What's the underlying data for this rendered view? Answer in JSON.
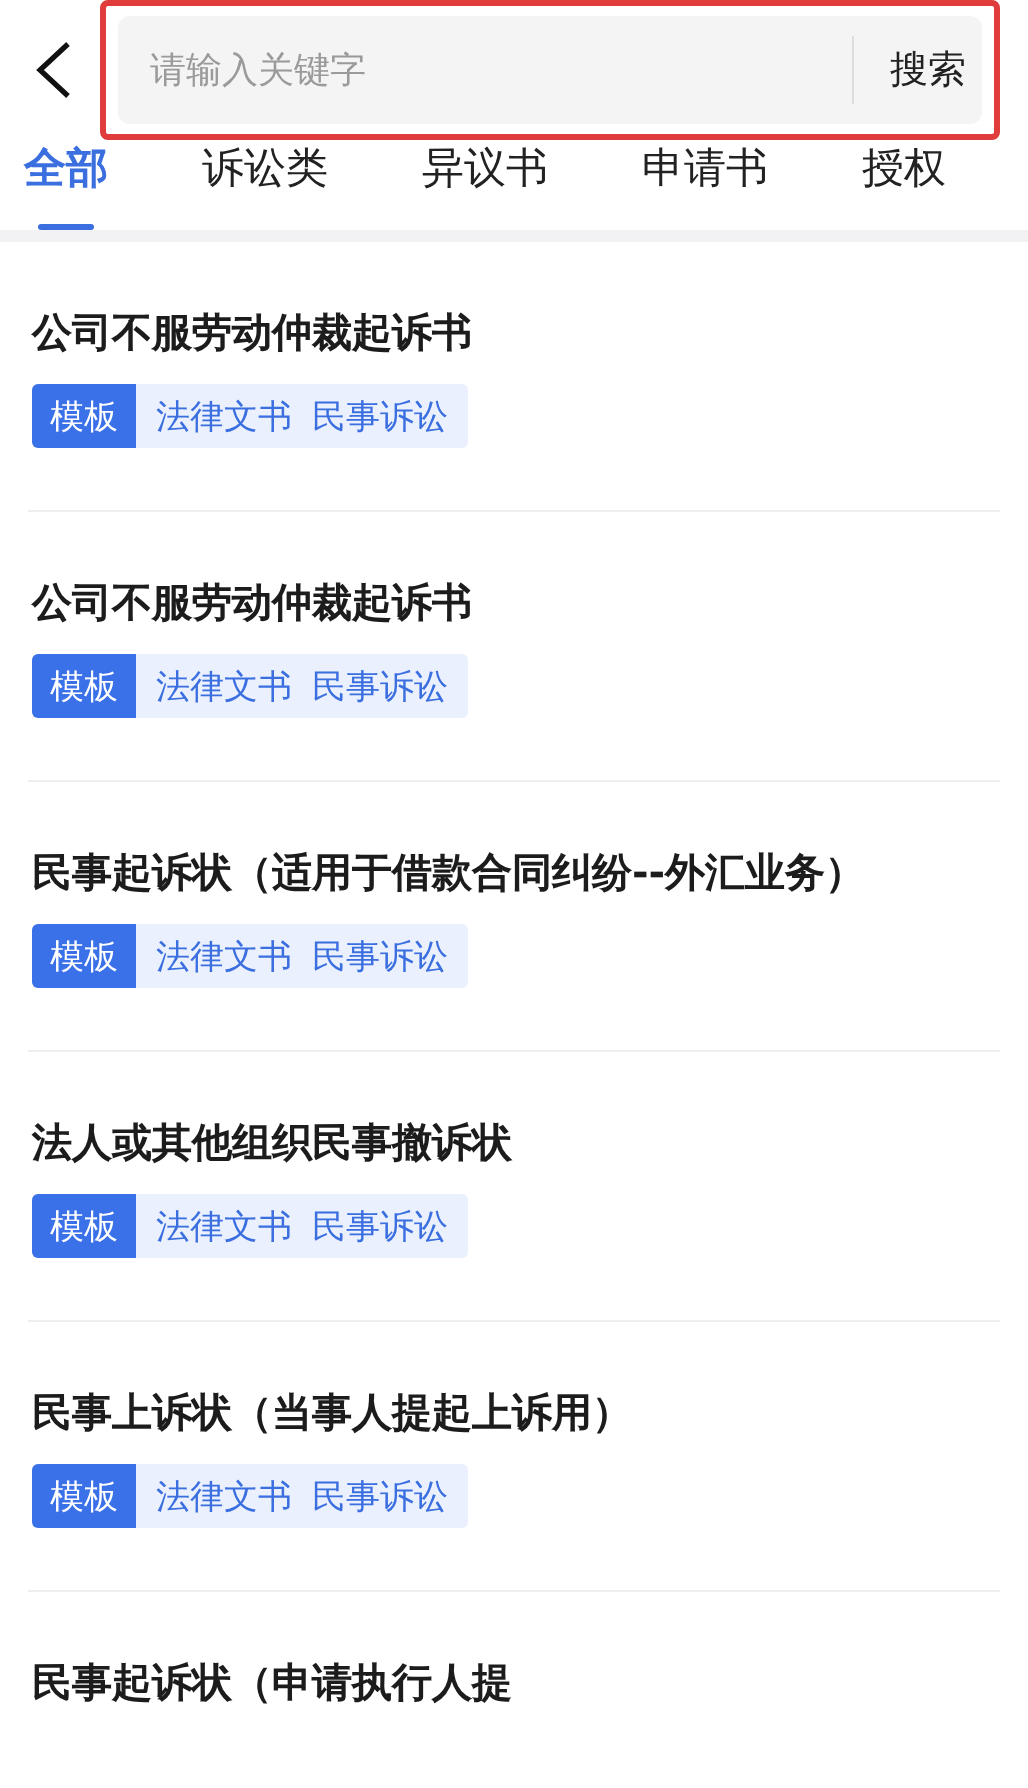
{
  "search": {
    "placeholder": "请输入关键字",
    "button": "搜索",
    "highlighted": true
  },
  "tabs": [
    {
      "label": "全部",
      "selected": true
    },
    {
      "label": "诉讼类",
      "selected": false
    },
    {
      "label": "异议书",
      "selected": false
    },
    {
      "label": "申请书",
      "selected": false
    },
    {
      "label": "授权",
      "selected": false
    }
  ],
  "documents": [
    {
      "title": "公司不服劳动仲裁起诉书",
      "type": "模板",
      "tags": [
        "法律文书",
        "民事诉讼"
      ]
    },
    {
      "title": "公司不服劳动仲裁起诉书",
      "type": "模板",
      "tags": [
        "法律文书",
        "民事诉讼"
      ]
    },
    {
      "title": "民事起诉状（适用于借款合同纠纷--外汇业务）",
      "type": "模板",
      "tags": [
        "法律文书",
        "民事诉讼"
      ]
    },
    {
      "title": "法人或其他组织民事撤诉状",
      "type": "模板",
      "tags": [
        "法律文书",
        "民事诉讼"
      ]
    },
    {
      "title": "民事上诉状（当事人提起上诉用）",
      "type": "模板",
      "tags": [
        "法律文书",
        "民事诉讼"
      ]
    },
    {
      "title": "民事起诉状（申请执行人提"
    }
  ]
}
